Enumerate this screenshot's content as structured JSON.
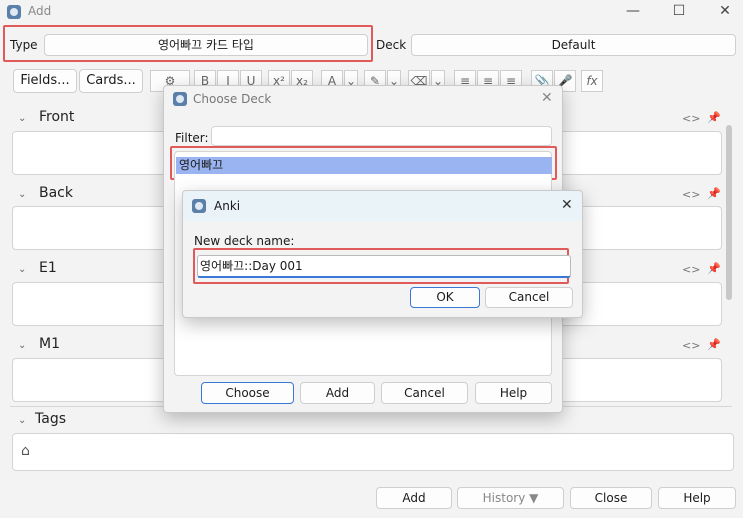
{
  "window": {
    "title": "Add",
    "minimize": "—",
    "maximize": "☐",
    "close": "✕"
  },
  "type_row": {
    "type_label": "Type",
    "type_value": "영어빠끄 카드 타입",
    "deck_label": "Deck",
    "deck_value": "Default"
  },
  "toolbar": {
    "fields_button": "Fields...",
    "cards_button": "Cards...",
    "format_buttons": [
      "B",
      "I",
      "U",
      "x²",
      "x₂",
      "A",
      "⌄",
      "✎",
      "⌄",
      "⌫",
      "⌄",
      "≡",
      "≡",
      "≡",
      "📎",
      "🎤",
      "fx"
    ]
  },
  "fields": [
    {
      "name": "Front"
    },
    {
      "name": "Back"
    },
    {
      "name": "E1"
    },
    {
      "name": "M1"
    }
  ],
  "tags": {
    "label": "Tags"
  },
  "bottom_buttons": {
    "add": "Add",
    "history": "History ▼",
    "close": "Close",
    "help": "Help"
  },
  "choose_deck_dialog": {
    "title": "Choose Deck",
    "filter_label": "Filter:",
    "filter_value": "",
    "selected_deck": "영어빠끄",
    "choose": "Choose",
    "add": "Add",
    "cancel": "Cancel",
    "help": "Help"
  },
  "new_deck_dialog": {
    "title": "Anki",
    "prompt": "New deck name:",
    "value": "영어빠끄::Day 001",
    "ok": "OK",
    "cancel": "Cancel"
  },
  "colors": {
    "highlight_red": "#e05a5a",
    "selection_blue": "#99b4f0",
    "focus_blue": "#3a78d8"
  }
}
